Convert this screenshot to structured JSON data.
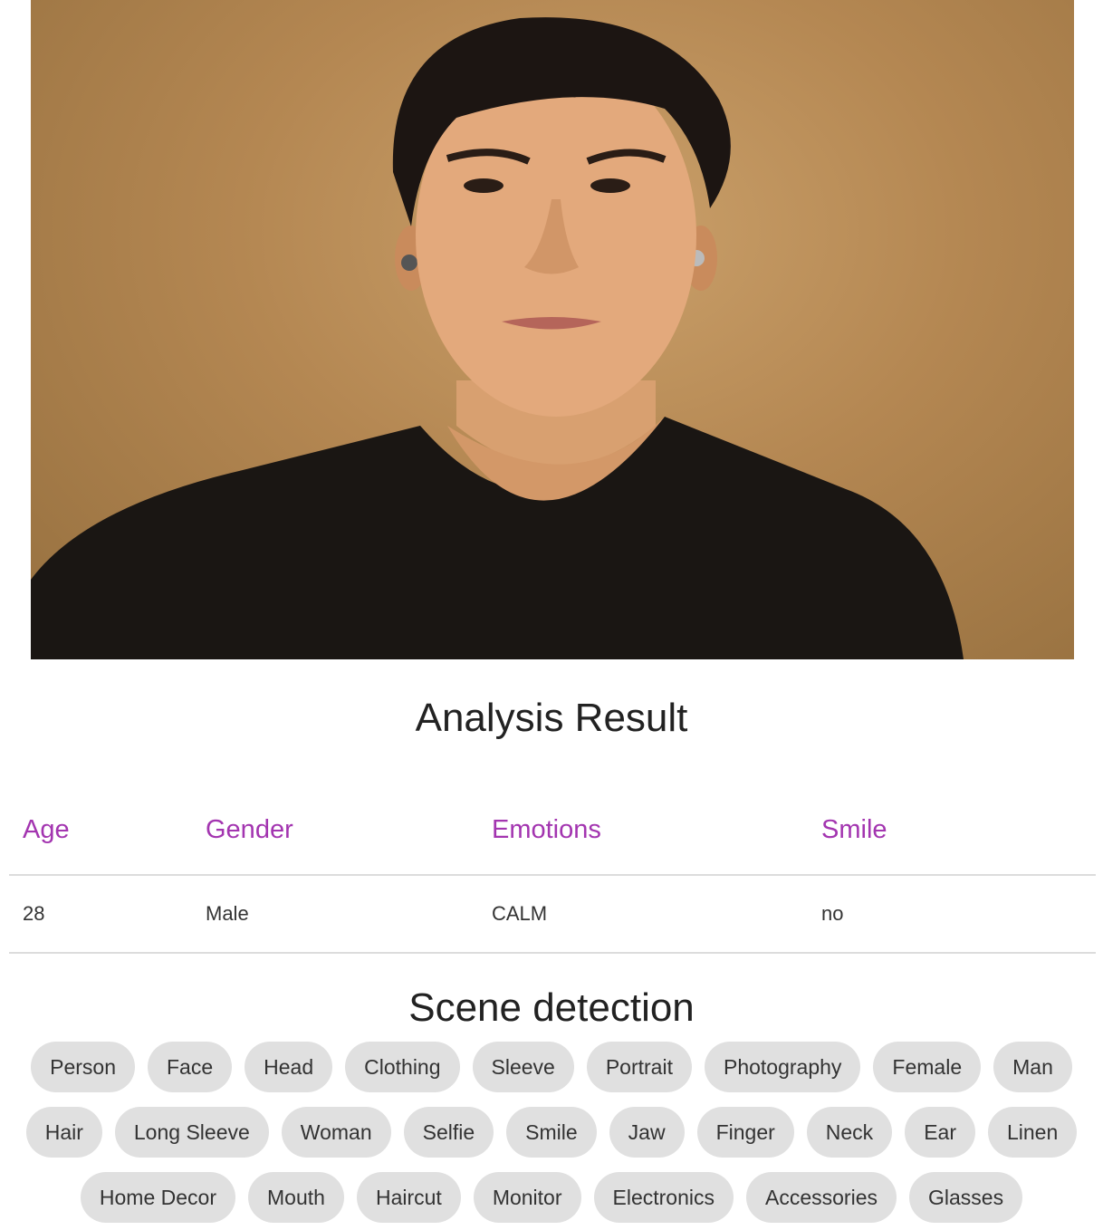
{
  "photo": {
    "description_icon": "portrait-photo"
  },
  "analysis": {
    "title": "Analysis Result",
    "headers": [
      "Age",
      "Gender",
      "Emotions",
      "Smile"
    ],
    "row": [
      "28",
      "Male",
      "CALM",
      "no"
    ]
  },
  "scene": {
    "title": "Scene detection",
    "tags": [
      "Person",
      "Face",
      "Head",
      "Clothing",
      "Sleeve",
      "Portrait",
      "Photography",
      "Female",
      "Man",
      "Hair",
      "Long Sleeve",
      "Woman",
      "Selfie",
      "Smile",
      "Jaw",
      "Finger",
      "Neck",
      "Ear",
      "Linen",
      "Home Decor",
      "Mouth",
      "Haircut",
      "Monitor",
      "Electronics",
      "Accessories",
      "Glasses"
    ]
  },
  "colors": {
    "header_accent": "#a335b0",
    "tag_bg": "#e0e0e0"
  }
}
